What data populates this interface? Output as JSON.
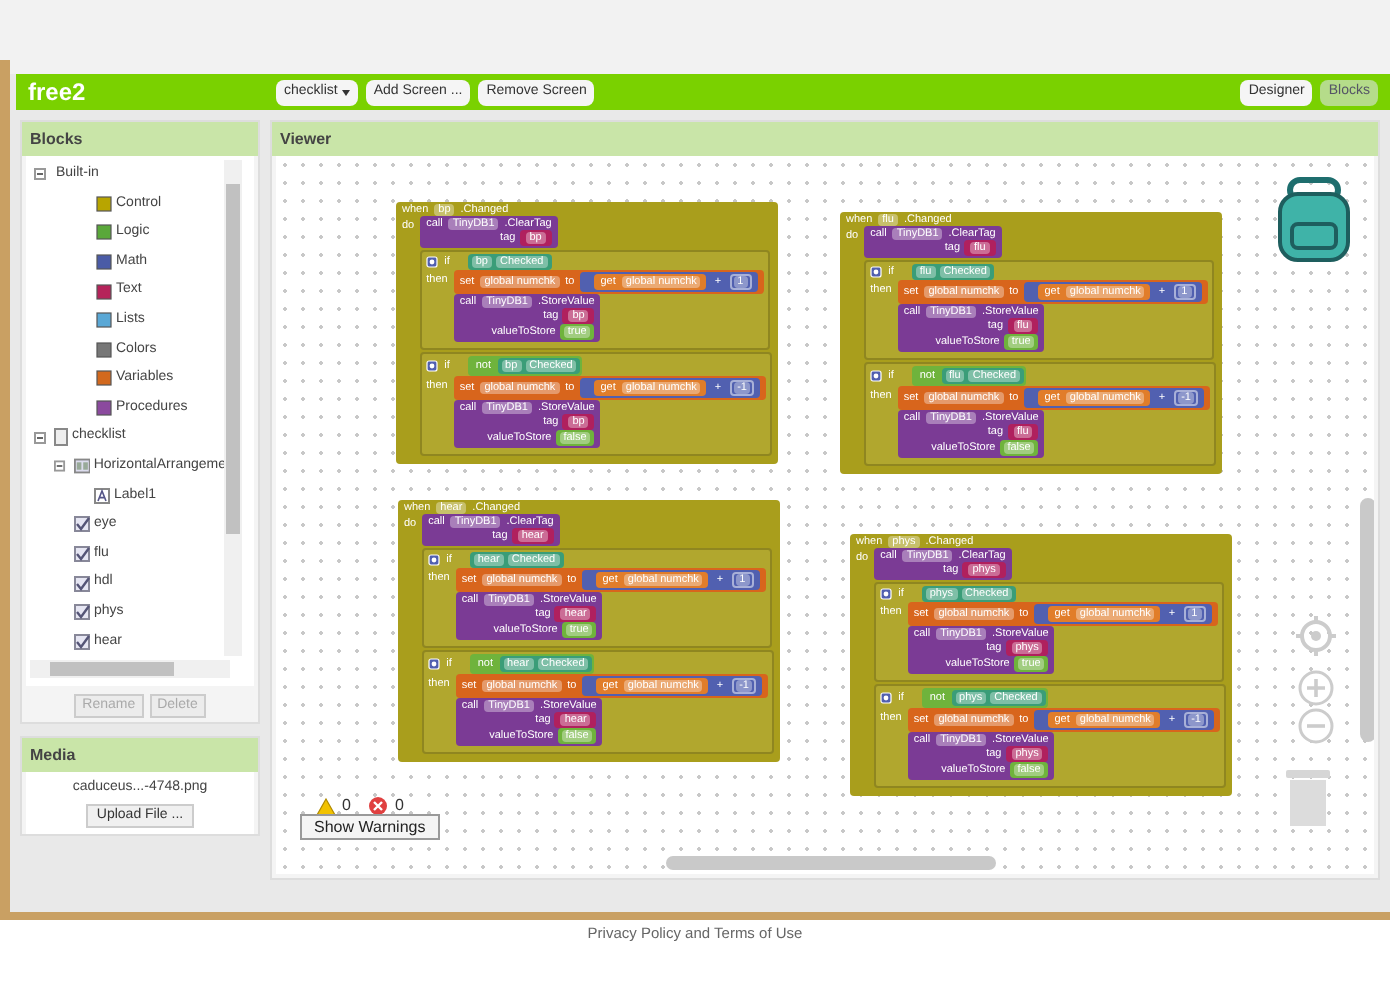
{
  "header": {
    "title": "free2",
    "screen_menu": "checklist",
    "buttons": [
      "Add Screen ...",
      "Remove Screen"
    ],
    "modes": [
      {
        "label": "Designer",
        "selected": false
      },
      {
        "label": "Blocks",
        "selected": true
      }
    ]
  },
  "blocks_panel": {
    "title": "Blocks",
    "tree": [
      {
        "label": "Built-in",
        "kind": "folder",
        "expanded": true,
        "children": [
          {
            "label": "Control",
            "kind": "category",
            "color": "#b8a500"
          },
          {
            "label": "Logic",
            "kind": "category",
            "color": "#5aa83a"
          },
          {
            "label": "Math",
            "kind": "category",
            "color": "#4a5ba6"
          },
          {
            "label": "Text",
            "kind": "category",
            "color": "#b5235a"
          },
          {
            "label": "Lists",
            "kind": "category",
            "color": "#5aa8d6"
          },
          {
            "label": "Colors",
            "kind": "category",
            "color": "#777777"
          },
          {
            "label": "Variables",
            "kind": "category",
            "color": "#d2691e"
          },
          {
            "label": "Procedures",
            "kind": "category",
            "color": "#8b4a9e"
          }
        ]
      },
      {
        "label": "checklist",
        "kind": "screen",
        "expanded": true,
        "children": [
          {
            "label": "HorizontalArrangeme",
            "kind": "arrangement",
            "expanded": true,
            "children": [
              {
                "label": "Label1",
                "kind": "label"
              }
            ]
          },
          {
            "label": "eye",
            "kind": "checkbox"
          },
          {
            "label": "flu",
            "kind": "checkbox"
          },
          {
            "label": "hdl",
            "kind": "checkbox"
          },
          {
            "label": "phys",
            "kind": "checkbox"
          },
          {
            "label": "hear",
            "kind": "checkbox"
          }
        ]
      }
    ],
    "buttons": [
      {
        "label": "Rename",
        "disabled": true
      },
      {
        "label": "Delete",
        "disabled": true
      }
    ]
  },
  "media_panel": {
    "title": "Media",
    "files": [
      "caduceus...-4748.png"
    ],
    "upload_button": "Upload File ..."
  },
  "viewer": {
    "title": "Viewer",
    "handlers": [
      {
        "when": "when",
        "component": "bp",
        "event": ".Changed",
        "do": "do",
        "clear": {
          "call": "call",
          "db": "TinyDB1",
          "method": ".ClearTag",
          "tag_label": "tag",
          "tag": "bp"
        },
        "branches": [
          {
            "if": "if",
            "component": "bp",
            "property": "Checked",
            "then": "then",
            "set": "set",
            "var": "global numchk",
            "to": "to",
            "get": "get",
            "get_var": "global numchk",
            "op": "+",
            "amount": "1",
            "store": {
              "call": "call",
              "db": "TinyDB1",
              "method": ".StoreValue",
              "tag_label": "tag",
              "tag": "bp",
              "value_label": "valueToStore",
              "value": "true"
            }
          },
          {
            "if": "if",
            "not": "not",
            "component": "bp",
            "property": "Checked",
            "then": "then",
            "set": "set",
            "var": "global numchk",
            "to": "to",
            "get": "get",
            "get_var": "global numchk",
            "op": "+",
            "amount": "-1",
            "store": {
              "call": "call",
              "db": "TinyDB1",
              "method": ".StoreValue",
              "tag_label": "tag",
              "tag": "bp",
              "value_label": "valueToStore",
              "value": "false"
            }
          }
        ]
      },
      {
        "when": "when",
        "component": "flu",
        "event": ".Changed",
        "do": "do",
        "clear": {
          "call": "call",
          "db": "TinyDB1",
          "method": ".ClearTag",
          "tag_label": "tag",
          "tag": "flu"
        },
        "branches": [
          {
            "if": "if",
            "component": "flu",
            "property": "Checked",
            "then": "then",
            "set": "set",
            "var": "global numchk",
            "to": "to",
            "get": "get",
            "get_var": "global numchk",
            "op": "+",
            "amount": "1",
            "store": {
              "call": "call",
              "db": "TinyDB1",
              "method": ".StoreValue",
              "tag_label": "tag",
              "tag": "flu",
              "value_label": "valueToStore",
              "value": "true"
            }
          },
          {
            "if": "if",
            "not": "not",
            "component": "flu",
            "property": "Checked",
            "then": "then",
            "set": "set",
            "var": "global numchk",
            "to": "to",
            "get": "get",
            "get_var": "global numchk",
            "op": "+",
            "amount": "-1",
            "store": {
              "call": "call",
              "db": "TinyDB1",
              "method": ".StoreValue",
              "tag_label": "tag",
              "tag": "flu",
              "value_label": "valueToStore",
              "value": "false"
            }
          }
        ]
      },
      {
        "when": "when",
        "component": "hear",
        "event": ".Changed",
        "do": "do",
        "clear": {
          "call": "call",
          "db": "TinyDB1",
          "method": ".ClearTag",
          "tag_label": "tag",
          "tag": "hear"
        },
        "branches": [
          {
            "if": "if",
            "component": "hear",
            "property": "Checked",
            "then": "then",
            "set": "set",
            "var": "global numchk",
            "to": "to",
            "get": "get",
            "get_var": "global numchk",
            "op": "+",
            "amount": "1",
            "store": {
              "call": "call",
              "db": "TinyDB1",
              "method": ".StoreValue",
              "tag_label": "tag",
              "tag": "hear",
              "value_label": "valueToStore",
              "value": "true"
            }
          },
          {
            "if": "if",
            "not": "not",
            "component": "hear",
            "property": "Checked",
            "then": "then",
            "set": "set",
            "var": "global numchk",
            "to": "to",
            "get": "get",
            "get_var": "global numchk",
            "op": "+",
            "amount": "-1",
            "store": {
              "call": "call",
              "db": "TinyDB1",
              "method": ".StoreValue",
              "tag_label": "tag",
              "tag": "hear",
              "value_label": "valueToStore",
              "value": "false"
            }
          }
        ]
      },
      {
        "when": "when",
        "component": "phys",
        "event": ".Changed",
        "do": "do",
        "clear": {
          "call": "call",
          "db": "TinyDB1",
          "method": ".ClearTag",
          "tag_label": "tag",
          "tag": "phys"
        },
        "branches": [
          {
            "if": "if",
            "component": "phys",
            "property": "Checked",
            "then": "then",
            "set": "set",
            "var": "global numchk",
            "to": "to",
            "get": "get",
            "get_var": "global numchk",
            "op": "+",
            "amount": "1",
            "store": {
              "call": "call",
              "db": "TinyDB1",
              "method": ".StoreValue",
              "tag_label": "tag",
              "tag": "phys",
              "value_label": "valueToStore",
              "value": "true"
            }
          },
          {
            "if": "if",
            "not": "not",
            "component": "phys",
            "property": "Checked",
            "then": "then",
            "set": "set",
            "var": "global numchk",
            "to": "to",
            "get": "get",
            "get_var": "global numchk",
            "op": "+",
            "amount": "-1",
            "store": {
              "call": "call",
              "db": "TinyDB1",
              "method": ".StoreValue",
              "tag_label": "tag",
              "tag": "phys",
              "value_label": "valueToStore",
              "value": "false"
            }
          }
        ]
      }
    ],
    "warnings": {
      "warning_count": "0",
      "error_count": "0",
      "button": "Show Warnings"
    }
  },
  "footer": "Privacy Policy and Terms of Use"
}
